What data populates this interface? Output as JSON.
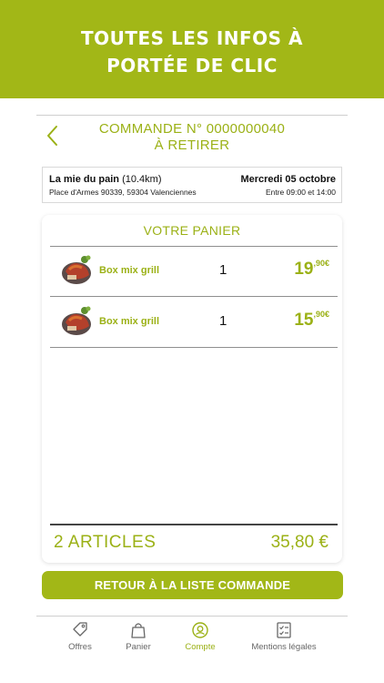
{
  "promo": {
    "line1": "TOUTES LES INFOS À",
    "line2": "PORTÉE DE CLIC"
  },
  "header": {
    "order_label": "COMMANDE N° 0000000040",
    "status": "À RETIRER"
  },
  "store": {
    "name": "La mie du pain",
    "distance": "(10.4km)",
    "address": "Place d'Armes 90339, 59304 Valenciennes",
    "date": "Mercredi 05 octobre",
    "time": "Entre 09:00 et 14:00"
  },
  "cart": {
    "title": "VOTRE PANIER",
    "items": [
      {
        "name": "Box mix grill",
        "qty": "1",
        "price_int": "19",
        "price_dec": ",90€"
      },
      {
        "name": "Box mix grill",
        "qty": "1",
        "price_int": "15",
        "price_dec": ",90€"
      }
    ],
    "total_label": "2 ARTICLES",
    "total_value": "35,80 €"
  },
  "return_button": "RETOUR À LA LISTE COMMANDE",
  "tabs": [
    {
      "label": "Offres",
      "icon": "tag-icon"
    },
    {
      "label": "Panier",
      "icon": "bag-icon"
    },
    {
      "label": "Compte",
      "icon": "account-icon",
      "active": true
    },
    {
      "label": "Mentions légales",
      "icon": "checklist-icon"
    }
  ],
  "colors": {
    "brand_green": "#a2b717",
    "text_green": "#9bb116",
    "inactive_gray": "#666666"
  }
}
